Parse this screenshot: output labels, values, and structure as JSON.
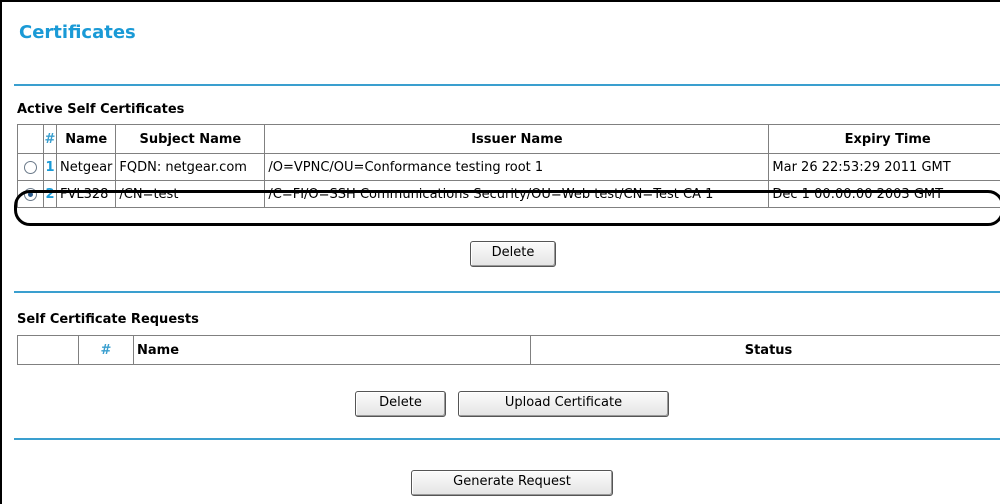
{
  "page": {
    "title": "Certificates"
  },
  "active_self_certificates": {
    "title": "Active Self Certificates",
    "columns": {
      "hash": "#",
      "name": "Name",
      "subject": "Subject Name",
      "issuer": "Issuer Name",
      "expiry": "Expiry Time"
    },
    "rows": [
      {
        "selected": false,
        "num": "1",
        "name": "Netgear",
        "subject": "FQDN: netgear.com",
        "issuer": "/O=VPNC/OU=Conformance testing root 1",
        "expiry": "Mar 26 22:53:29 2011 GMT"
      },
      {
        "selected": true,
        "num": "2",
        "name": "FVL328",
        "subject": "/CN=test",
        "issuer": "/C=FI/O=SSH Communications Security/OU=Web test/CN=Test CA 1",
        "expiry": "Dec 1 00:00:00 2003 GMT"
      }
    ],
    "delete_label": "Delete"
  },
  "self_certificate_requests": {
    "title": "Self Certificate Requests",
    "columns": {
      "hash": "#",
      "name": "Name",
      "status": "Status"
    },
    "delete_label": "Delete",
    "upload_label": "Upload Certificate"
  },
  "generate_request_label": "Generate Request"
}
